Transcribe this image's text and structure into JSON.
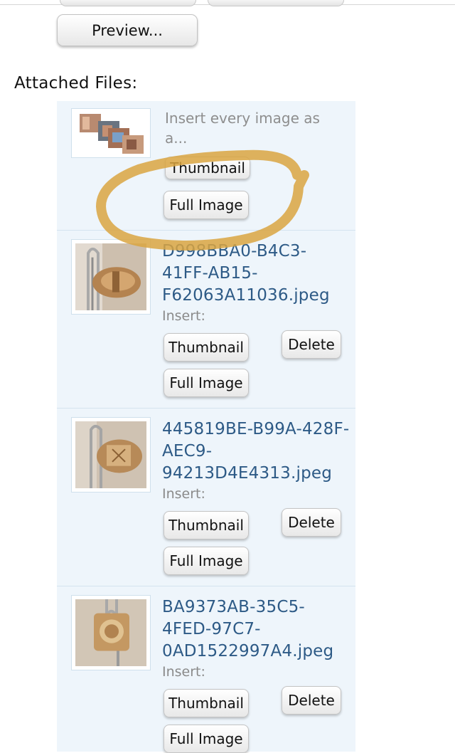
{
  "preview_label": "Preview...",
  "attached_files_label": "Attached Files:",
  "bulk": {
    "prompt": "Insert every image as a...",
    "thumbnail_label": "Thumbnail",
    "full_image_label": "Full Image"
  },
  "files": [
    {
      "name_lines": [
        "D998BBA0-B4C3-",
        "41FF-AB15-",
        "F62063A11036.jpeg"
      ],
      "insert_label": "Insert:",
      "thumbnail_label": "Thumbnail",
      "full_image_label": "Full Image",
      "delete_label": "Delete"
    },
    {
      "name_lines": [
        "445819BE-B99A-428F-",
        "AEC9-",
        "94213D4E4313.jpeg"
      ],
      "insert_label": "Insert:",
      "thumbnail_label": "Thumbnail",
      "full_image_label": "Full Image",
      "delete_label": "Delete"
    },
    {
      "name_lines": [
        "BA9373AB-35C5-",
        "4FED-97C7-",
        "0AD1522997A4.jpeg"
      ],
      "insert_label": "Insert:",
      "thumbnail_label": "Thumbnail",
      "full_image_label": "Full Image",
      "delete_label": "Delete"
    }
  ],
  "colors": {
    "panel_bg": "#eef5fb",
    "link": "#2d5a86",
    "annotation": "#d9a441"
  }
}
